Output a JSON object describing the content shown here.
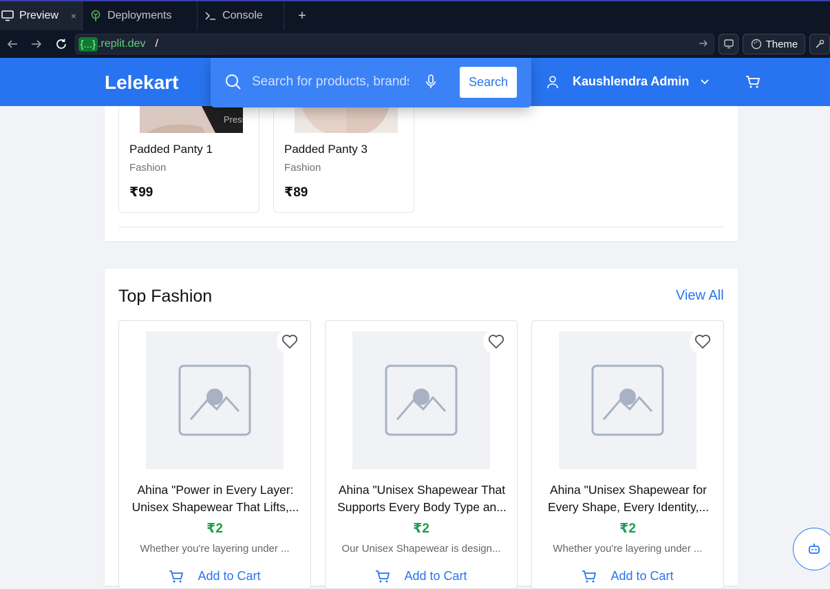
{
  "tabs": [
    {
      "label": "Preview",
      "close": "×"
    },
    {
      "label": "Deployments"
    },
    {
      "label": "Console"
    }
  ],
  "tab_add": "+",
  "url": {
    "tag": "{...}",
    "host": ".replit.dev",
    "path": "/"
  },
  "chrome": {
    "theme_label": "Theme"
  },
  "header": {
    "logo": "Lelekart",
    "search_placeholder": "Search for products, brands and more",
    "search_button": "Search",
    "user_name": "Kaushlendra Admin"
  },
  "overlay_text": "Press        to search",
  "small_products": [
    {
      "name": "Padded Panty 1",
      "category": "Fashion",
      "price": "₹99"
    },
    {
      "name": "Padded Panty 3",
      "category": "Fashion",
      "price": "₹89"
    }
  ],
  "section": {
    "title": "Top Fashion",
    "view_all": "View All"
  },
  "products": [
    {
      "title": "Ahina \"Power in Every Layer: Unisex Shapewear That Lifts,...",
      "price": "₹2",
      "desc": "Whether you're layering under ...",
      "add_to_cart": "Add to Cart"
    },
    {
      "title": "Ahina \"Unisex Shapewear That Supports Every Body Type an...",
      "price": "₹2",
      "desc": "Our Unisex Shapewear is design...",
      "add_to_cart": "Add to Cart"
    },
    {
      "title": "Ahina \"Unisex Shapewear for Every Shape, Every Identity,...",
      "price": "₹2",
      "desc": "Whether you're layering under ...",
      "add_to_cart": "Add to Cart"
    }
  ],
  "colors": {
    "brand": "#2874f0",
    "price_green": "#1a9e4b",
    "chrome_bg": "#0e1525"
  }
}
